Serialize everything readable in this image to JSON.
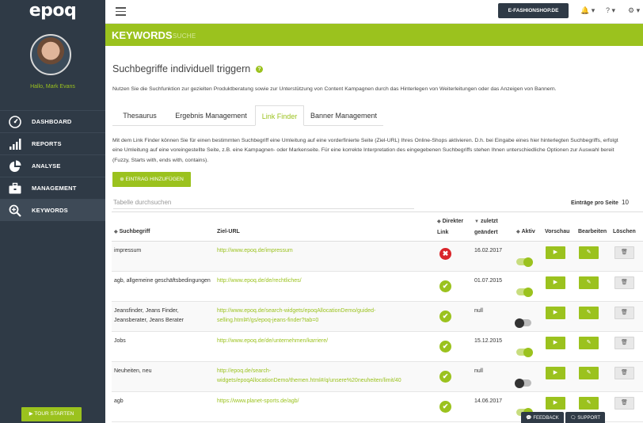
{
  "app": {
    "logo": "epoq"
  },
  "user": {
    "greeting": "Hallo, Mark Evans"
  },
  "sidebar": {
    "items": [
      {
        "label": "DASHBOARD",
        "icon": "dashboard-icon"
      },
      {
        "label": "REPORTS",
        "icon": "bar-chart-icon"
      },
      {
        "label": "ANALYSE",
        "icon": "pie-chart-icon"
      },
      {
        "label": "MANAGEMENT",
        "icon": "briefcase-icon"
      },
      {
        "label": "KEYWORDS",
        "icon": "search-plus-icon",
        "active": true
      }
    ],
    "tour_button": "▶ TOUR STARTEN"
  },
  "topbar": {
    "shop_select": "E-FASHIONSHOP.DE",
    "bell": "🔔 ▾",
    "help": "? ▾",
    "settings": "⚙ ▾"
  },
  "header": {
    "title": "KEYWORDS",
    "subtitle": "SUCHE"
  },
  "main": {
    "section_title": "Suchbegriffe individuell triggern",
    "help_icon": "?",
    "intro": "Nutzen Sie die Suchfunktion zur gezielten Produktberatung sowie zur Unterstützung von Content Kampagnen durch das Hinterlegen von Weiterleitungen oder das Anzeigen von Bannern.",
    "tabs": [
      {
        "label": "Thesaurus"
      },
      {
        "label": "Ergebnis Management"
      },
      {
        "label": "Link Finder",
        "active": true
      },
      {
        "label": "Banner Management"
      }
    ],
    "description": "Mit dem Link Finder können Sie für einen bestimmten Suchbegriff eine Umleitung auf eine vorderfinierte Seite (Ziel-URL) Ihres Online-Shops aktivieren. D.h. bei Eingabe eines hier hinterlegten Suchbegriffs, erfolgt eine Umleitung auf eine voreingestellte Seite, z.B. eine Kampagnen- oder Markenseite. Für eine korrekte Interpretation des eingegebenen Suchbegriffs stehen Ihnen unterschiedliche Optionen zur Auswahl bereit (Fuzzy, Starts with, ends with, contains).",
    "add_button": "⊕ EINTRAG HINZUFÜGEN",
    "search_placeholder": "Tabelle durchsuchen",
    "per_page_label": "Einträge pro Seite",
    "per_page_value": "10"
  },
  "table": {
    "headers": {
      "keyword": "Suchbegriff",
      "url": "Ziel-URL",
      "direct_link_1": "Direkter",
      "direct_link_2": "Link",
      "changed_1": "zuletzt",
      "changed_2": "geändert",
      "active": "Aktiv",
      "preview": "Vorschau",
      "edit": "Bearbeiten",
      "delete": "Löschen"
    },
    "rows": [
      {
        "keyword": "impressum",
        "url": "http://www.epoq.de/impressum",
        "direct": false,
        "date": "16.02.2017",
        "active": true
      },
      {
        "keyword": "agb, allgemeine geschäftsbedingungen",
        "url": "http://www.epoq.de/de/rechtliches/",
        "direct": true,
        "date": "01.07.2015",
        "active": true
      },
      {
        "keyword": "Jeansfinder, Jeans Finder, Jeansberater, Jeans Berater",
        "url": "http://www.epoq.de/search-widgets/epoqAllocationDemo/guided-selling.html#!/gs/epoq-jeans-finder?tab=0",
        "direct": true,
        "date": "null",
        "active": false
      },
      {
        "keyword": "Jobs",
        "url": "http://www.epoq.de/de/unternehmen/karriere/",
        "direct": true,
        "date": "15.12.2015",
        "active": true
      },
      {
        "keyword": "Neuheiten, neu",
        "url": "http://epoq.de/search-widgets/epoqAllocationDemo/themen.html#/q/unsere%20neuheiten/limit/40",
        "direct": true,
        "date": "null",
        "active": false
      },
      {
        "keyword": "agb",
        "url": "https://www.planet-sports.de/agb/",
        "direct": true,
        "date": "14.06.2017",
        "active": true
      }
    ]
  },
  "footer": {
    "feedback": "💬 FEEDBACK",
    "support": "🗨 SUPPORT"
  },
  "colors": {
    "accent": "#9bc21e",
    "sidebar": "#2f3a46",
    "danger": "#d9242a"
  }
}
